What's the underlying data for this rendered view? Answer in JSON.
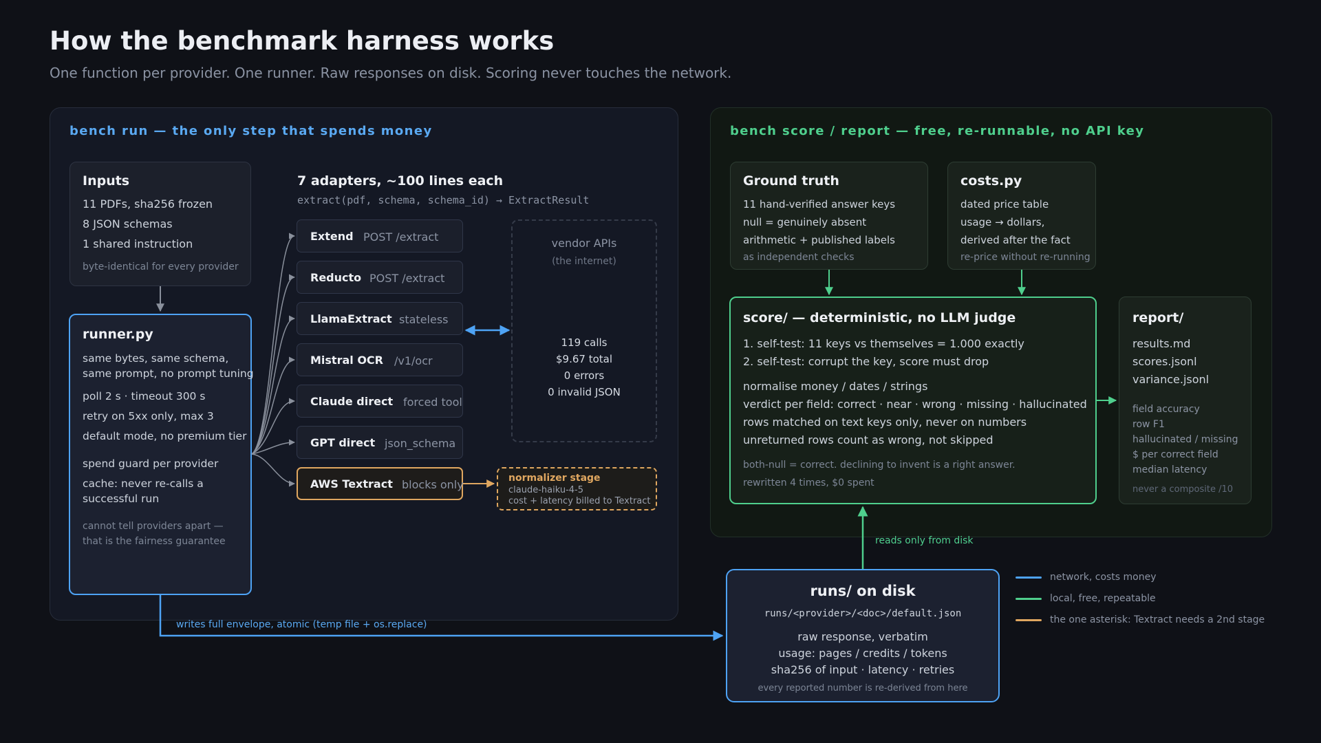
{
  "title": "How the benchmark harness works",
  "subtitle": "One function per provider. One runner. Raw responses on disk. Scoring never touches the network.",
  "colors": {
    "blue": "#4ea3f5",
    "green": "#4fcf8d",
    "orange": "#e0a760",
    "grey": "#8a909c"
  },
  "run_panel": {
    "title": "bench run — the only step that spends money",
    "inputs": {
      "title": "Inputs",
      "lines": [
        "11 PDFs, sha256 frozen",
        "8 JSON schemas",
        "1 shared instruction"
      ],
      "note": "byte-identical for every provider"
    },
    "runner": {
      "title": "runner.py",
      "group1": [
        "same bytes, same schema,",
        "same prompt, no prompt tuning"
      ],
      "group2": [
        "poll 2 s · timeout 300 s",
        "retry on 5xx only, max 3",
        "default mode, no premium tier"
      ],
      "group3": [
        "spend guard per provider",
        "cache: never re-calls a",
        "successful run"
      ],
      "note": [
        "cannot tell providers apart —",
        "that is the fairness guarantee"
      ]
    },
    "adapters": {
      "title": "7 adapters, ~100 lines each",
      "signature": "extract(pdf, schema, schema_id) → ExtractResult",
      "items": [
        {
          "name": "Extend",
          "endpoint": "POST /extract"
        },
        {
          "name": "Reducto",
          "endpoint": "POST /extract"
        },
        {
          "name": "LlamaExtract",
          "endpoint": "stateless"
        },
        {
          "name": "Mistral OCR",
          "endpoint": "/v1/ocr"
        },
        {
          "name": "Claude direct",
          "endpoint": "forced tool"
        },
        {
          "name": "GPT direct",
          "endpoint": "json_schema"
        },
        {
          "name": "AWS Textract",
          "endpoint": "blocks only"
        }
      ]
    },
    "vendor": {
      "title": "vendor APIs",
      "subtitle": "(the internet)",
      "stats": [
        "119 calls",
        "$9.67 total",
        "0 errors",
        "0 invalid JSON"
      ]
    },
    "normalizer": {
      "title": "normalizer stage",
      "lines": [
        "claude-haiku-4-5",
        "cost + latency billed to Textract"
      ]
    }
  },
  "score_panel": {
    "title": "bench score / report — free, re-runnable, no API key",
    "ground_truth": {
      "title": "Ground truth",
      "lines": [
        "11 hand-verified answer keys",
        "null = genuinely absent",
        "arithmetic + published labels"
      ],
      "note": "as independent checks"
    },
    "costs": {
      "title": "costs.py",
      "lines": [
        "dated price table",
        "usage → dollars,",
        "derived after the fact"
      ],
      "note": "re-price without re-running"
    },
    "score": {
      "title": "score/ — deterministic, no LLM judge",
      "tests": [
        "1. self-test: 11 keys vs themselves = 1.000 exactly",
        "2. self-test: corrupt the key, score must drop"
      ],
      "rules": [
        "normalise money / dates / strings",
        "verdict per field: correct · near · wrong · missing · hallucinated",
        "rows matched on text keys only, never on numbers",
        "unreturned rows count as wrong, not skipped"
      ],
      "notes": [
        "both-null = correct. declining to invent is a right answer.",
        "rewritten 4 times, $0 spent"
      ]
    },
    "report": {
      "title": "report/",
      "files": [
        "results.md",
        "scores.jsonl",
        "variance.jsonl"
      ],
      "metrics": [
        "field accuracy",
        "row F1",
        "hallucinated / missing",
        "$ per correct field",
        "median latency"
      ],
      "note": "never a composite /10"
    }
  },
  "disk": {
    "title": "runs/ on disk",
    "path": "runs/<provider>/<doc>/default.json",
    "lines": [
      "raw response, verbatim",
      "usage: pages / credits / tokens",
      "sha256 of input · latency · retries"
    ],
    "note": "every reported number is re-derived from here"
  },
  "edge_labels": {
    "writes": "writes full envelope, atomic (temp file + os.replace)",
    "reads": "reads only from disk"
  },
  "legend": [
    {
      "label": "network, costs money",
      "color": "#4ea3f5"
    },
    {
      "label": "local, free, repeatable",
      "color": "#4fcf8d"
    },
    {
      "label": "the one asterisk: Textract needs a 2nd stage",
      "color": "#e0a760"
    }
  ]
}
